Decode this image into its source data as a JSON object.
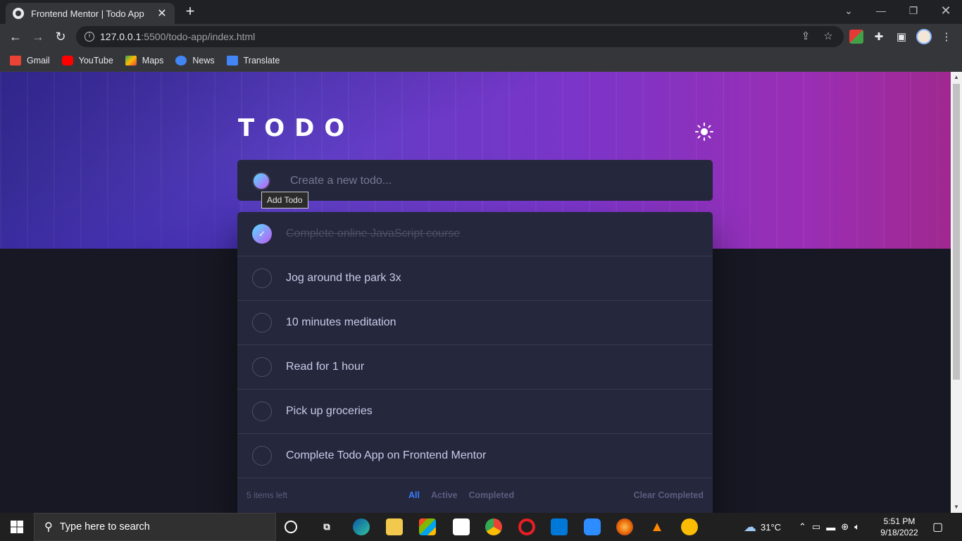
{
  "browser": {
    "tab_title": "Frontend Mentor | Todo App",
    "url_host": "127.0.0.1",
    "url_path": ":5500/todo-app/index.html",
    "bookmarks": [
      {
        "label": "Gmail",
        "color": "#ea4335"
      },
      {
        "label": "YouTube",
        "color": "#ff0000"
      },
      {
        "label": "Maps",
        "color": "#34a853"
      },
      {
        "label": "News",
        "color": "#4285f4"
      },
      {
        "label": "Translate",
        "color": "#4285f4"
      }
    ]
  },
  "app": {
    "title": "TODO",
    "new_todo_placeholder": "Create a new todo...",
    "add_tooltip": "Add Todo",
    "todos": [
      {
        "text": "Complete online JavaScript course",
        "completed": true
      },
      {
        "text": "Jog around the park 3x",
        "completed": false
      },
      {
        "text": "10 minutes meditation",
        "completed": false
      },
      {
        "text": "Read for 1 hour",
        "completed": false
      },
      {
        "text": "Pick up groceries",
        "completed": false
      },
      {
        "text": "Complete Todo App on Frontend Mentor",
        "completed": false
      }
    ],
    "items_left": "5 items left",
    "filters": {
      "all": "All",
      "active": "Active",
      "completed": "Completed"
    },
    "active_filter": "All",
    "clear_completed": "Clear Completed",
    "colors": {
      "accent": "#3a7cfd",
      "gradient_start": "#57ddff",
      "gradient_end": "#c058f3",
      "card": "#25273d",
      "background": "#171823"
    }
  },
  "taskbar": {
    "search_placeholder": "Type here to search",
    "weather": "31°C",
    "time": "5:51 PM",
    "date": "9/18/2022"
  }
}
